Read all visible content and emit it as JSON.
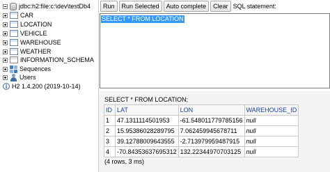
{
  "tree": {
    "connection": "jdbc:h2:file:c:\\dev\\testDb4",
    "tables": [
      "CAR",
      "LOCATION",
      "VEHICLE",
      "WAREHOUSE",
      "WEATHER"
    ],
    "schema": "INFORMATION_SCHEMA",
    "sequences": "Sequences",
    "users": "Users",
    "version": "H2 1.4.200 (2019-10-14)"
  },
  "toolbar": {
    "run": "Run",
    "run_selected": "Run Selected",
    "auto_complete": "Auto complete",
    "clear": "Clear",
    "sql_label": "SQL statement:"
  },
  "editor": {
    "text": "SELECT * FROM LOCATION"
  },
  "result": {
    "query": "SELECT * FROM LOCATION;",
    "columns": [
      "ID",
      "LAT",
      "LON",
      "WAREHOUSE_ID"
    ],
    "rows": [
      [
        "1",
        "47.1311114501953",
        "-61.548011779785156",
        "null"
      ],
      [
        "2",
        "15.95386028289795",
        "7.062459945678711",
        "null"
      ],
      [
        "3",
        "39.12788009643555",
        "-2.713979959487915",
        "null"
      ],
      [
        "4",
        "-70.84353637695312",
        "132.22344970703125",
        "null"
      ]
    ],
    "footer": "(4 rows, 3 ms)"
  }
}
